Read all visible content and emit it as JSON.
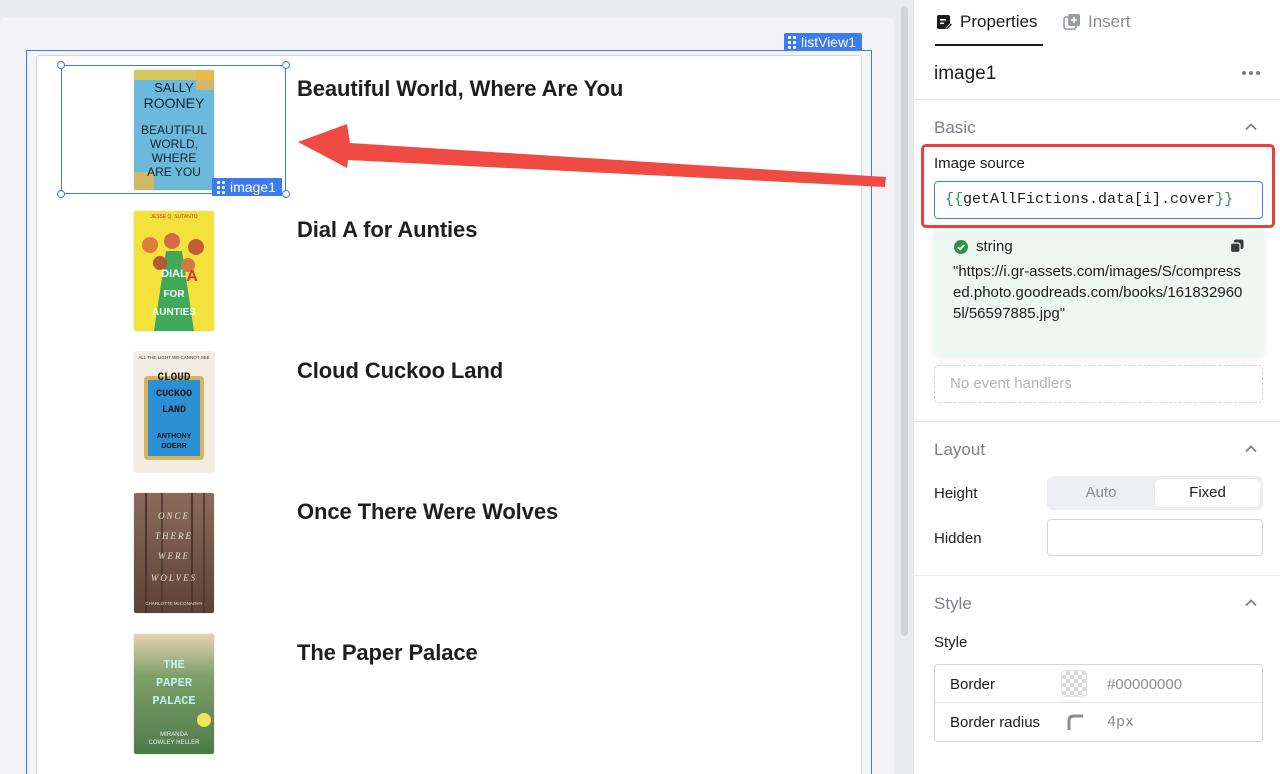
{
  "canvas": {
    "listview_tag": "listView1",
    "selected_tag": "image1",
    "items": [
      {
        "title": "Beautiful World, Where Are You",
        "cover_text": [
          "SALLY",
          "ROONEY",
          "BEAUTIFUL",
          "WORLD,",
          "WHERE",
          "ARE YOU"
        ],
        "cover_bg": "#6cb9dc"
      },
      {
        "title": "Dial A for Aunties",
        "cover_text": [
          "JESSE Q. SUTANTO",
          "DIAL",
          "A",
          "FOR",
          "AUNTIES"
        ],
        "cover_bg": "#f3e23b"
      },
      {
        "title": "Cloud Cuckoo Land",
        "cover_text": [
          "ALL THE LIGHT WE CANNOT SEE",
          "CLOUD",
          "CUCKOO",
          "LAND",
          "ANTHONY",
          "DOERR"
        ],
        "cover_bg": "#e9dcc0"
      },
      {
        "title": "Once There Were Wolves",
        "cover_text": [
          "ONCE",
          "THERE",
          "WERE",
          "WOLVES",
          "CHARLOTTE McCONAGHY"
        ],
        "cover_bg": "#7a5a4c"
      },
      {
        "title": "The Paper Palace",
        "cover_text": [
          "THE",
          "PAPER",
          "PALACE",
          "MIRANDA",
          "COWLEY HELLER"
        ],
        "cover_bg": "#6e9a6a"
      }
    ]
  },
  "panel": {
    "tabs": [
      {
        "label": "Properties",
        "icon": "properties-icon",
        "active": true
      },
      {
        "label": "Insert",
        "icon": "insert-icon",
        "active": false
      }
    ],
    "component_name": "image1",
    "more_icon": "more-icon",
    "sections": {
      "basic": "Basic",
      "layout": "Layout",
      "style": "Style"
    },
    "image_source": {
      "label": "Image source",
      "value": "{{getAllFictions.data[i].cover}}",
      "value_open": "{{",
      "value_expr": "getAllFictions.data[i].cover",
      "value_close": "}}"
    },
    "eval": {
      "type": "string",
      "value": "\"https://i.gr-assets.com/images/S/compressed.photo.goodreads.com/books/1618329605l/56597885.jpg\""
    },
    "event_handlers_placeholder": "No event handlers",
    "height": {
      "label": "Height",
      "options": [
        "Auto",
        "Fixed"
      ],
      "selected": "Fixed"
    },
    "hidden": {
      "label": "Hidden",
      "value": ""
    },
    "style": {
      "label": "Style",
      "border_label": "Border",
      "border_color": "#00000000",
      "radius_label": "Border radius",
      "radius_value": "4px"
    }
  },
  "colors": {
    "accent": "#3d7cf0",
    "highlight": "#e5423d",
    "success": "#2f8f4b"
  }
}
